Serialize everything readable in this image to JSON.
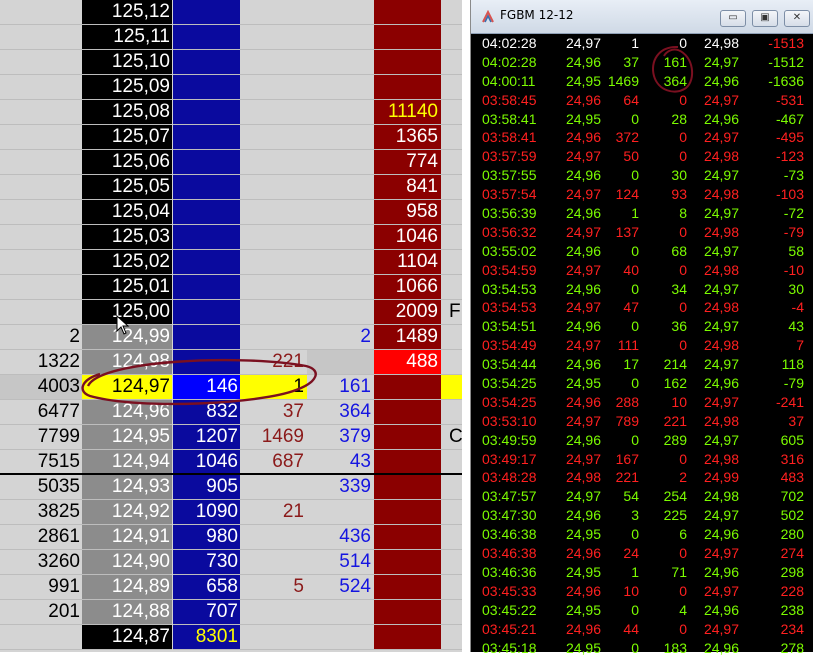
{
  "colors": {
    "ladder_bg": "#d4d4d4",
    "price_black": "#000000",
    "price_gray": "#8c8c8c",
    "bid_blue": "#0a0a9e",
    "ask_darkred": "#8b0000",
    "highlight_yellow": "#ffff00",
    "bright_red": "#ff0000",
    "trade_green": "#7cfc00",
    "trade_red": "#ff2020",
    "annotation": "#7a1020"
  },
  "ladder": {
    "rows": [
      {
        "a": "",
        "p": "125,12",
        "b": "",
        "d": "",
        "e": "",
        "f": "",
        "g": "",
        "pcol": "black",
        "bcol": "blue",
        "fcol": "darkred"
      },
      {
        "a": "",
        "p": "125,11",
        "b": "",
        "d": "",
        "e": "",
        "f": "",
        "g": "",
        "pcol": "black",
        "bcol": "blue",
        "fcol": "darkred"
      },
      {
        "a": "",
        "p": "125,10",
        "b": "",
        "d": "",
        "e": "",
        "f": "",
        "g": "",
        "pcol": "black",
        "bcol": "blue",
        "fcol": "darkred"
      },
      {
        "a": "",
        "p": "125,09",
        "b": "",
        "d": "",
        "e": "",
        "f": "",
        "g": "",
        "pcol": "black",
        "bcol": "blue",
        "fcol": "darkred"
      },
      {
        "a": "",
        "p": "125,08",
        "b": "",
        "d": "",
        "e": "",
        "f": "11140",
        "g": "",
        "pcol": "black",
        "bcol": "blue",
        "fcol": "darkred",
        "ftext": "yellow"
      },
      {
        "a": "",
        "p": "125,07",
        "b": "",
        "d": "",
        "e": "",
        "f": "1365",
        "g": "",
        "pcol": "black",
        "bcol": "blue",
        "fcol": "darkred"
      },
      {
        "a": "",
        "p": "125,06",
        "b": "",
        "d": "",
        "e": "",
        "f": "774",
        "g": "",
        "pcol": "black",
        "bcol": "blue",
        "fcol": "darkred"
      },
      {
        "a": "",
        "p": "125,05",
        "b": "",
        "d": "",
        "e": "",
        "f": "841",
        "g": "",
        "pcol": "black",
        "bcol": "blue",
        "fcol": "darkred"
      },
      {
        "a": "",
        "p": "125,04",
        "b": "",
        "d": "",
        "e": "",
        "f": "958",
        "g": "",
        "pcol": "black",
        "bcol": "blue",
        "fcol": "darkred"
      },
      {
        "a": "",
        "p": "125,03",
        "b": "",
        "d": "",
        "e": "",
        "f": "1046",
        "g": "",
        "pcol": "black",
        "bcol": "blue",
        "fcol": "darkred"
      },
      {
        "a": "",
        "p": "125,02",
        "b": "",
        "d": "",
        "e": "",
        "f": "1104",
        "g": "",
        "pcol": "black",
        "bcol": "blue",
        "fcol": "darkred"
      },
      {
        "a": "",
        "p": "125,01",
        "b": "",
        "d": "",
        "e": "",
        "f": "1066",
        "g": "",
        "pcol": "black",
        "bcol": "blue",
        "fcol": "darkred"
      },
      {
        "a": "",
        "p": "125,00",
        "b": "",
        "d": "",
        "e": "",
        "f": "2009",
        "g": "F",
        "pcol": "black",
        "bcol": "blue",
        "fcol": "darkred"
      },
      {
        "a": "2",
        "p": "124,99",
        "b": "",
        "d": "",
        "e": "2",
        "f": "1489",
        "g": "",
        "pcol": "gray",
        "bcol": "blue",
        "fcol": "darkred"
      },
      {
        "a": "1322",
        "p": "124,98",
        "b": "",
        "d": "221",
        "e": "",
        "f": "488",
        "g": "",
        "pcol": "gray",
        "bcol": "blue",
        "fcol": "brightred",
        "ecol": "gray"
      },
      {
        "a": "4003",
        "p": "124,97",
        "b": "146",
        "d": "1",
        "e": "161",
        "f": "",
        "g": "",
        "pcol": "yellow",
        "bcol": "brightblue",
        "fcol": "darkred",
        "dcol": "yellow",
        "gcol": "yellow"
      },
      {
        "a": "6477",
        "p": "124,96",
        "b": "832",
        "d": "37",
        "e": "364",
        "f": "",
        "g": "",
        "pcol": "gray",
        "bcol": "blue",
        "fcol": "darkred"
      },
      {
        "a": "7799",
        "p": "124,95",
        "b": "1207",
        "d": "1469",
        "e": "379",
        "f": "",
        "g": "C",
        "pcol": "gray",
        "bcol": "blue",
        "fcol": "darkred"
      },
      {
        "a": "7515",
        "p": "124,94",
        "b": "1046",
        "d": "687",
        "e": "43",
        "f": "",
        "g": "",
        "pcol": "gray",
        "bcol": "blue",
        "fcol": "darkred"
      },
      {
        "a": "5035",
        "p": "124,93",
        "b": "905",
        "d": "",
        "e": "339",
        "f": "",
        "g": "",
        "pcol": "gray",
        "bcol": "blue",
        "fcol": "darkred"
      },
      {
        "a": "3825",
        "p": "124,92",
        "b": "1090",
        "d": "21",
        "e": "",
        "f": "",
        "g": "",
        "pcol": "gray",
        "bcol": "blue",
        "fcol": "darkred"
      },
      {
        "a": "2861",
        "p": "124,91",
        "b": "980",
        "d": "",
        "e": "436",
        "f": "",
        "g": "",
        "pcol": "gray",
        "bcol": "blue",
        "fcol": "darkred"
      },
      {
        "a": "3260",
        "p": "124,90",
        "b": "730",
        "d": "",
        "e": "514",
        "f": "",
        "g": "",
        "pcol": "gray",
        "bcol": "blue",
        "fcol": "darkred"
      },
      {
        "a": "991",
        "p": "124,89",
        "b": "658",
        "d": "5",
        "e": "524",
        "f": "",
        "g": "",
        "pcol": "gray",
        "bcol": "blue",
        "fcol": "darkred"
      },
      {
        "a": "201",
        "p": "124,88",
        "b": "707",
        "d": "",
        "e": "",
        "f": "",
        "g": "",
        "pcol": "gray",
        "bcol": "blue",
        "fcol": "darkred"
      },
      {
        "a": "",
        "p": "124,87",
        "b": "8301",
        "d": "",
        "e": "",
        "f": "",
        "g": "",
        "pcol": "black",
        "bcol": "blue",
        "fcol": "darkred",
        "btext": "yellow"
      }
    ]
  },
  "time_sales": {
    "title": "FGBM 12-12",
    "buttons": {
      "minimize": "▭",
      "restore": "▣",
      "close": "✕"
    },
    "rows": [
      {
        "t": "04:02:28",
        "p": "24,97",
        "v1": "1",
        "v2": "0",
        "b": "24,98",
        "d": "-1513",
        "c": "w"
      },
      {
        "t": "04:02:28",
        "p": "24,96",
        "v1": "37",
        "v2": "161",
        "b": "24,97",
        "d": "-1512",
        "c": "g"
      },
      {
        "t": "04:00:11",
        "p": "24,95",
        "v1": "1469",
        "v2": "364",
        "b": "24,96",
        "d": "-1636",
        "c": "g"
      },
      {
        "t": "03:58:45",
        "p": "24,96",
        "v1": "64",
        "v2": "0",
        "b": "24,97",
        "d": "-531",
        "c": "r"
      },
      {
        "t": "03:58:41",
        "p": "24,95",
        "v1": "0",
        "v2": "28",
        "b": "24,96",
        "d": "-467",
        "c": "g"
      },
      {
        "t": "03:58:41",
        "p": "24,96",
        "v1": "372",
        "v2": "0",
        "b": "24,97",
        "d": "-495",
        "c": "r"
      },
      {
        "t": "03:57:59",
        "p": "24,97",
        "v1": "50",
        "v2": "0",
        "b": "24,98",
        "d": "-123",
        "c": "r"
      },
      {
        "t": "03:57:55",
        "p": "24,96",
        "v1": "0",
        "v2": "30",
        "b": "24,97",
        "d": "-73",
        "c": "g"
      },
      {
        "t": "03:57:54",
        "p": "24,97",
        "v1": "124",
        "v2": "93",
        "b": "24,98",
        "d": "-103",
        "c": "r"
      },
      {
        "t": "03:56:39",
        "p": "24,96",
        "v1": "1",
        "v2": "8",
        "b": "24,97",
        "d": "-72",
        "c": "g"
      },
      {
        "t": "03:56:32",
        "p": "24,97",
        "v1": "137",
        "v2": "0",
        "b": "24,98",
        "d": "-79",
        "c": "r"
      },
      {
        "t": "03:55:02",
        "p": "24,96",
        "v1": "0",
        "v2": "68",
        "b": "24,97",
        "d": "58",
        "c": "g"
      },
      {
        "t": "03:54:59",
        "p": "24,97",
        "v1": "40",
        "v2": "0",
        "b": "24,98",
        "d": "-10",
        "c": "r"
      },
      {
        "t": "03:54:53",
        "p": "24,96",
        "v1": "0",
        "v2": "34",
        "b": "24,97",
        "d": "30",
        "c": "g"
      },
      {
        "t": "03:54:53",
        "p": "24,97",
        "v1": "47",
        "v2": "0",
        "b": "24,98",
        "d": "-4",
        "c": "r"
      },
      {
        "t": "03:54:51",
        "p": "24,96",
        "v1": "0",
        "v2": "36",
        "b": "24,97",
        "d": "43",
        "c": "g"
      },
      {
        "t": "03:54:49",
        "p": "24,97",
        "v1": "111",
        "v2": "0",
        "b": "24,98",
        "d": "7",
        "c": "r"
      },
      {
        "t": "03:54:44",
        "p": "24,96",
        "v1": "17",
        "v2": "214",
        "b": "24,97",
        "d": "118",
        "c": "g"
      },
      {
        "t": "03:54:25",
        "p": "24,95",
        "v1": "0",
        "v2": "162",
        "b": "24,96",
        "d": "-79",
        "c": "g"
      },
      {
        "t": "03:54:25",
        "p": "24,96",
        "v1": "288",
        "v2": "10",
        "b": "24,97",
        "d": "-241",
        "c": "r"
      },
      {
        "t": "03:53:10",
        "p": "24,97",
        "v1": "789",
        "v2": "221",
        "b": "24,98",
        "d": "37",
        "c": "r"
      },
      {
        "t": "03:49:59",
        "p": "24,96",
        "v1": "0",
        "v2": "289",
        "b": "24,97",
        "d": "605",
        "c": "g"
      },
      {
        "t": "03:49:17",
        "p": "24,97",
        "v1": "167",
        "v2": "0",
        "b": "24,98",
        "d": "316",
        "c": "r"
      },
      {
        "t": "03:48:28",
        "p": "24,98",
        "v1": "221",
        "v2": "2",
        "b": "24,99",
        "d": "483",
        "c": "r"
      },
      {
        "t": "03:47:57",
        "p": "24,97",
        "v1": "54",
        "v2": "254",
        "b": "24,98",
        "d": "702",
        "c": "g"
      },
      {
        "t": "03:47:30",
        "p": "24,96",
        "v1": "3",
        "v2": "225",
        "b": "24,97",
        "d": "502",
        "c": "g"
      },
      {
        "t": "03:46:38",
        "p": "24,95",
        "v1": "0",
        "v2": "6",
        "b": "24,96",
        "d": "280",
        "c": "g"
      },
      {
        "t": "03:46:38",
        "p": "24,96",
        "v1": "24",
        "v2": "0",
        "b": "24,97",
        "d": "274",
        "c": "r"
      },
      {
        "t": "03:46:36",
        "p": "24,95",
        "v1": "1",
        "v2": "71",
        "b": "24,96",
        "d": "298",
        "c": "g"
      },
      {
        "t": "03:45:33",
        "p": "24,96",
        "v1": "10",
        "v2": "0",
        "b": "24,97",
        "d": "228",
        "c": "r"
      },
      {
        "t": "03:45:22",
        "p": "24,95",
        "v1": "0",
        "v2": "4",
        "b": "24,96",
        "d": "238",
        "c": "g"
      },
      {
        "t": "03:45:21",
        "p": "24,96",
        "v1": "44",
        "v2": "0",
        "b": "24,97",
        "d": "234",
        "c": "r"
      },
      {
        "t": "03:45:18",
        "p": "24,95",
        "v1": "0",
        "v2": "183",
        "b": "24,96",
        "d": "278",
        "c": "g"
      }
    ]
  }
}
